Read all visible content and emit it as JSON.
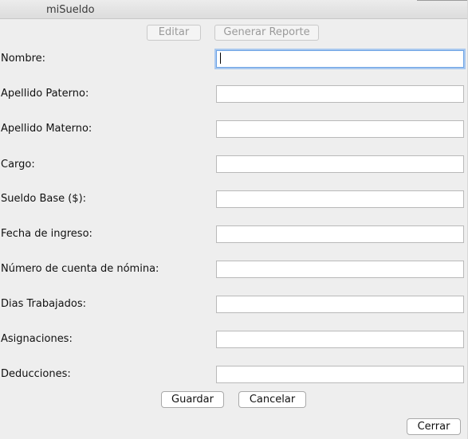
{
  "window": {
    "title": "miSueldo"
  },
  "toolbar": {
    "edit_label": "Editar",
    "report_label": "Generar Reporte"
  },
  "form": {
    "fields": [
      {
        "label": "Nombre:",
        "value": ""
      },
      {
        "label": "Apellido Paterno:",
        "value": ""
      },
      {
        "label": "Apellido Materno:",
        "value": ""
      },
      {
        "label": "Cargo:",
        "value": ""
      },
      {
        "label": "Sueldo Base ($):",
        "value": ""
      },
      {
        "label": "Fecha de ingreso:",
        "value": ""
      },
      {
        "label": "Número de cuenta de nómina:",
        "value": ""
      },
      {
        "label": "Dias Trabajados:",
        "value": ""
      },
      {
        "label": "Asignaciones:",
        "value": ""
      },
      {
        "label": "Deducciones:",
        "value": ""
      }
    ]
  },
  "actions": {
    "save_label": "Guardar",
    "cancel_label": "Cancelar",
    "close_label": "Cerrar"
  },
  "colors": {
    "window_bg": "#eeeeee",
    "focus_ring": "#a9c8ef",
    "disabled_text": "#9a9a9a"
  }
}
